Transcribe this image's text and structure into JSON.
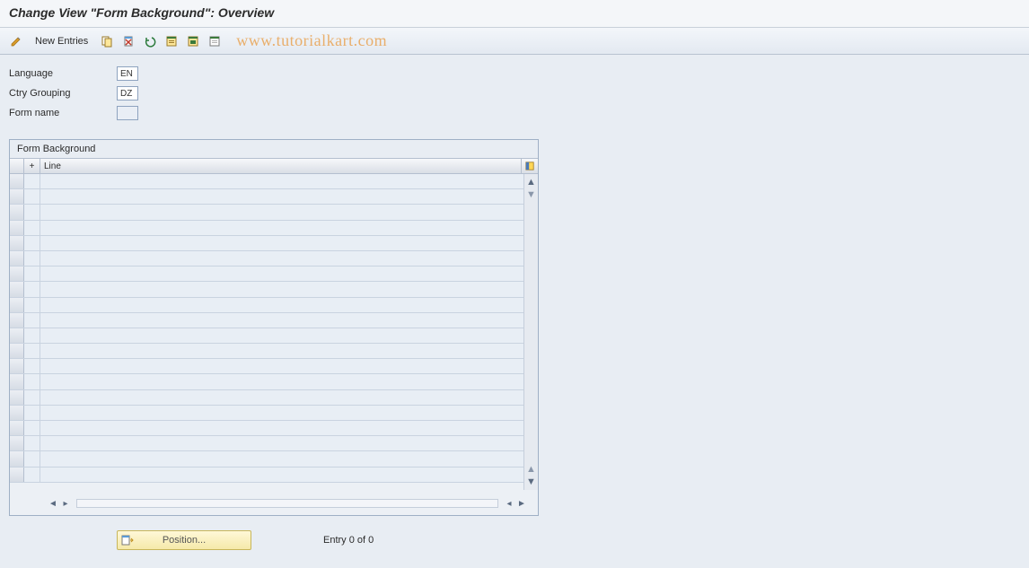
{
  "title": "Change View \"Form Background\": Overview",
  "toolbar": {
    "new_entries_label": "New Entries"
  },
  "watermark": "www.tutorialkart.com",
  "form": {
    "language_label": "Language",
    "language_value": "EN",
    "ctry_grouping_label": "Ctry Grouping",
    "ctry_grouping_value": "DZ",
    "form_name_label": "Form name",
    "form_name_value": ""
  },
  "table": {
    "panel_title": "Form Background",
    "col_plus": "+",
    "col_line": "Line",
    "row_count": 20
  },
  "footer": {
    "position_label": "Position...",
    "entry_text": "Entry 0 of 0"
  }
}
